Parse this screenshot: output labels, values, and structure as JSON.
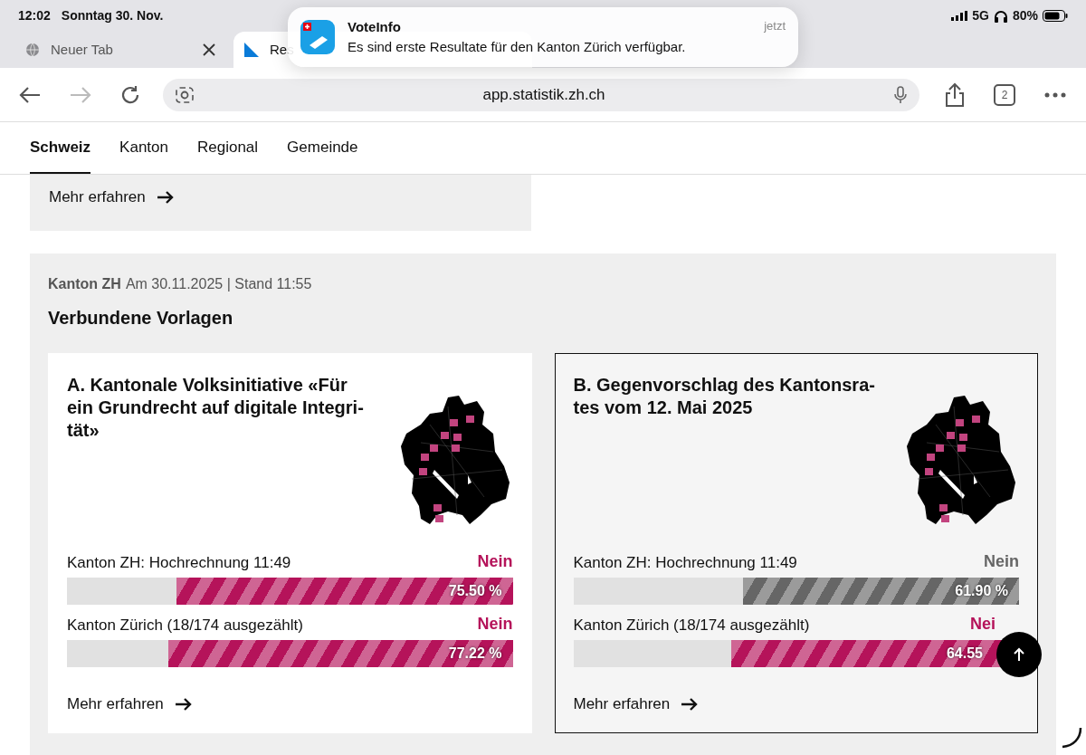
{
  "status_bar": {
    "time": "12:02",
    "date": "Sonntag 30. Nov.",
    "network": "5G",
    "battery": "80%"
  },
  "notification": {
    "app": "VoteInfo",
    "time": "jetzt",
    "message": "Es sind erste Resultate für den Kanton Zürich verfügbar."
  },
  "browser_tabs": [
    {
      "title": "Neuer Tab",
      "selected": false
    },
    {
      "title": "Res",
      "selected": true
    }
  ],
  "address_bar": {
    "url": "app.statistik.zh.ch"
  },
  "tab_count": "2",
  "nav_tabs": [
    {
      "label": "Schweiz",
      "selected": true
    },
    {
      "label": "Kanton",
      "selected": false
    },
    {
      "label": "Regional",
      "selected": false
    },
    {
      "label": "Gemeinde",
      "selected": false
    }
  ],
  "top_card": {
    "link": "Mehr erfahren"
  },
  "section": {
    "region": "Kanton ZH",
    "date": "Am 30.11.2025 | Stand 11:55",
    "title": "Verbundene Vorlagen"
  },
  "proposals": [
    {
      "title": "A. Kantonale Volksinitiative «Für ein Grundrecht auf digitale Integri-tät»",
      "selected": false,
      "link": "Mehr erfahren",
      "results": [
        {
          "label": "Kanton ZH: Hochrechnung 11:49",
          "verdict": "Nein",
          "value": "75.50 %",
          "level": 0.755,
          "color": "#b5135a"
        },
        {
          "label": "Kanton Zürich (18/174 ausgezählt)",
          "verdict": "Nein",
          "value": "77.22 %",
          "level": 0.772,
          "color": "#b5135a"
        }
      ]
    },
    {
      "title": "B. Gegenvorschlag des Kantonsra-tes vom 12. Mai 2025",
      "selected": true,
      "link": "Mehr erfahren",
      "results": [
        {
          "label": "Kanton ZH: Hochrechnung 11:49",
          "verdict": "Nein",
          "value": "61.90 %",
          "level": 0.619,
          "color": "#666666"
        },
        {
          "label": "Kanton Zürich (18/174 ausgezählt)",
          "verdict": "Nei",
          "value": "64.55",
          "level": 0.6455,
          "color": "#b5135a"
        }
      ]
    }
  ]
}
